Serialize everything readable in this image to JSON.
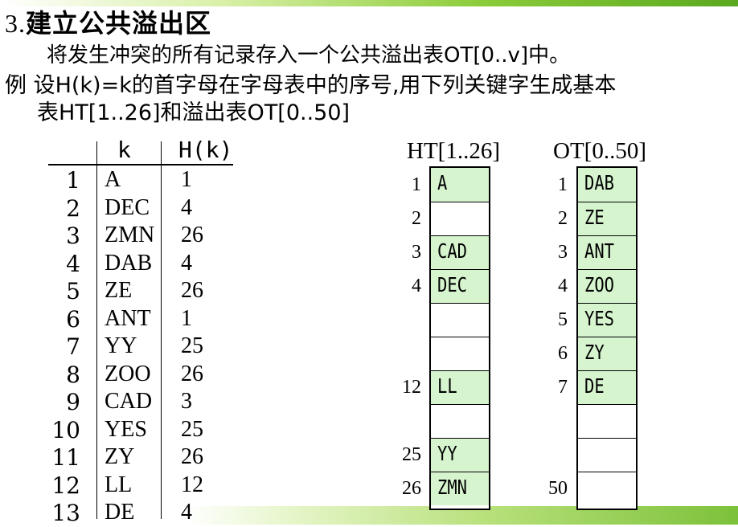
{
  "heading": {
    "number": "3.",
    "title": "建立公共溢出区"
  },
  "lines": [
    "将发生冲突的所有记录存入一个公共溢出表OT[0..v]中。",
    "例  设H(k)=k的首字母在字母表中的序号,用下列关键字生成基本",
    "表HT[1..26]和溢出表OT[0..50]"
  ],
  "key_table": {
    "headers": [
      "k",
      "H(k)"
    ],
    "rows": [
      {
        "i": "1",
        "k": "A",
        "h": "1"
      },
      {
        "i": "2",
        "k": "DEC",
        "h": "4"
      },
      {
        "i": "3",
        "k": "ZMN",
        "h": "26"
      },
      {
        "i": "4",
        "k": "DAB",
        "h": "4"
      },
      {
        "i": "5",
        "k": "ZE",
        "h": "26"
      },
      {
        "i": "6",
        "k": "ANT",
        "h": "1"
      },
      {
        "i": "7",
        "k": "YY",
        "h": "25"
      },
      {
        "i": "8",
        "k": "ZOO",
        "h": "26"
      },
      {
        "i": "9",
        "k": "CAD",
        "h": "3"
      },
      {
        "i": "10",
        "k": "YES",
        "h": "25"
      },
      {
        "i": "11",
        "k": "ZY",
        "h": "26"
      },
      {
        "i": "12",
        "k": "LL",
        "h": "12"
      },
      {
        "i": "13",
        "k": "DE",
        "h": "4"
      }
    ]
  },
  "ht": {
    "title": "HT[1..26]",
    "cells": [
      {
        "label": "1",
        "value": "A"
      },
      {
        "label": "2",
        "value": ""
      },
      {
        "label": "3",
        "value": "CAD"
      },
      {
        "label": "4",
        "value": "DEC"
      },
      {
        "label": "",
        "value": ""
      },
      {
        "label": "",
        "value": ""
      },
      {
        "label": "12",
        "value": "LL"
      },
      {
        "label": "",
        "value": ""
      },
      {
        "label": "25",
        "value": "YY"
      },
      {
        "label": "26",
        "value": "ZMN"
      }
    ]
  },
  "ot": {
    "title": "OT[0..50]",
    "cells": [
      {
        "label": "1",
        "value": "DAB"
      },
      {
        "label": "2",
        "value": "ZE"
      },
      {
        "label": "3",
        "value": "ANT"
      },
      {
        "label": "4",
        "value": "ZOO"
      },
      {
        "label": "5",
        "value": "YES"
      },
      {
        "label": "6",
        "value": "ZY"
      },
      {
        "label": "7",
        "value": "DE"
      },
      {
        "label": "",
        "value": ""
      },
      {
        "label": "",
        "value": ""
      },
      {
        "label": "50",
        "value": ""
      }
    ]
  },
  "colors": {
    "filled_cell": "#d6f5cf",
    "accent_green": "#8ccc3a"
  }
}
